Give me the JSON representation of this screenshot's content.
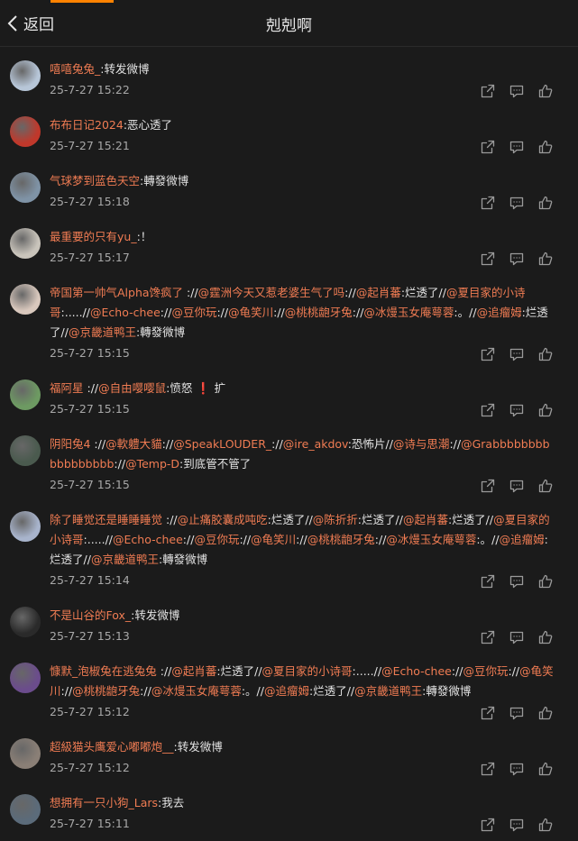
{
  "header": {
    "back_label": "返回",
    "title": "剋剋啊"
  },
  "comments": [
    {
      "name": "嘻嘻兔兔_",
      "segments": [
        {
          "t": ":转发微博"
        }
      ],
      "time": "25-7-27 15:22",
      "avatar": "#b7c6d8"
    },
    {
      "name": "布布日记2024",
      "segments": [
        {
          "t": ":恶心透了"
        }
      ],
      "time": "25-7-27 15:21",
      "avatar": "#c0382b"
    },
    {
      "name": "气球梦到蓝色天空",
      "segments": [
        {
          "t": ":轉發微博"
        }
      ],
      "time": "25-7-27 15:18",
      "avatar": "#7f93a6"
    },
    {
      "name": "最重要的只有yu_",
      "segments": [
        {
          "t": ":！"
        }
      ],
      "time": "25-7-27 15:17",
      "avatar": "#c9c4bb"
    },
    {
      "name": "帝国第一帅气Alpha馋疯了",
      "segments": [
        {
          "t": " ://"
        },
        {
          "t": "@霆洲今天又惹老婆生气了吗",
          "a": 1
        },
        {
          "t": "://"
        },
        {
          "t": "@起肖蕃",
          "a": 1
        },
        {
          "t": ":烂透了//"
        },
        {
          "t": "@夏目家的小诗哥",
          "a": 1
        },
        {
          "t": ":.....//"
        },
        {
          "t": "@Echo-chee",
          "a": 1
        },
        {
          "t": "://"
        },
        {
          "t": "@豆你玩",
          "a": 1
        },
        {
          "t": "://"
        },
        {
          "t": "@龟笑川",
          "a": 1
        },
        {
          "t": "://"
        },
        {
          "t": "@桃桃龅牙兔",
          "a": 1
        },
        {
          "t": "://"
        },
        {
          "t": "@冰熳玉女庵萼蓉",
          "a": 1
        },
        {
          "t": ":。//"
        },
        {
          "t": "@追瘤姆",
          "a": 1
        },
        {
          "t": ":烂透了//"
        },
        {
          "t": "@京畿道鸭王",
          "a": 1
        },
        {
          "t": ":轉發微博"
        }
      ],
      "time": "25-7-27 15:15",
      "avatar": "#d9c8bd"
    },
    {
      "name": "福阿星",
      "segments": [
        {
          "t": " ://"
        },
        {
          "t": "@自由嘤嘤鼠",
          "a": 1
        },
        {
          "t": ":愤怒"
        },
        {
          "t": " ❗ ",
          "r": 1
        },
        {
          "t": " 扩"
        }
      ],
      "time": "25-7-27 15:15",
      "avatar": "#6d9a62"
    },
    {
      "name": "阴阳兔4",
      "segments": [
        {
          "t": " ://"
        },
        {
          "t": "@軟軆大貓",
          "a": 1
        },
        {
          "t": "://"
        },
        {
          "t": "@SpeakLOUDER_",
          "a": 1
        },
        {
          "t": "://"
        },
        {
          "t": "@ire_akdov",
          "a": 1
        },
        {
          "t": ":恐怖片//"
        },
        {
          "t": "@诗与思潮",
          "a": 1
        },
        {
          "t": "://"
        },
        {
          "t": "@Grabbbbbbbbbbbbbbbbb",
          "a": 1
        },
        {
          "t": "://"
        },
        {
          "t": "@Temp-D",
          "a": 1
        },
        {
          "t": ":到底管不管了"
        }
      ],
      "time": "25-7-27 15:15",
      "avatar": "#4a5a4e"
    },
    {
      "name": "除了睡觉还是睡睡睡觉",
      "segments": [
        {
          "t": " ://"
        },
        {
          "t": "@止痛胶囊成吨吃",
          "a": 1
        },
        {
          "t": ":烂透了//"
        },
        {
          "t": "@陈折折",
          "a": 1
        },
        {
          "t": ":烂透了//"
        },
        {
          "t": "@起肖蕃",
          "a": 1
        },
        {
          "t": ":烂透了//"
        },
        {
          "t": "@夏目家的小诗哥",
          "a": 1
        },
        {
          "t": ":.....//"
        },
        {
          "t": "@Echo-chee",
          "a": 1
        },
        {
          "t": "://"
        },
        {
          "t": "@豆你玩",
          "a": 1
        },
        {
          "t": "://"
        },
        {
          "t": "@龟笑川",
          "a": 1
        },
        {
          "t": "://"
        },
        {
          "t": "@桃桃龅牙兔",
          "a": 1
        },
        {
          "t": "://"
        },
        {
          "t": "@冰熳玉女庵萼蓉",
          "a": 1
        },
        {
          "t": ":。//"
        },
        {
          "t": "@追瘤姆",
          "a": 1
        },
        {
          "t": ":烂透了//"
        },
        {
          "t": "@京畿道鸭王",
          "a": 1
        },
        {
          "t": ":轉發微博"
        }
      ],
      "time": "25-7-27 15:14",
      "avatar": "#a8b4cc"
    },
    {
      "name": "不是山谷的Fox_",
      "segments": [
        {
          "t": ":转发微博"
        }
      ],
      "time": "25-7-27 15:13",
      "avatar": "#2a2a2a"
    },
    {
      "name": "慷默_泡椒兔在逃兔兔",
      "segments": [
        {
          "t": " ://"
        },
        {
          "t": "@起肖蕃",
          "a": 1
        },
        {
          "t": ":烂透了//"
        },
        {
          "t": "@夏目家的小诗哥",
          "a": 1
        },
        {
          "t": ":.....//"
        },
        {
          "t": "@Echo-chee",
          "a": 1
        },
        {
          "t": "://"
        },
        {
          "t": "@豆你玩",
          "a": 1
        },
        {
          "t": "://"
        },
        {
          "t": "@龟笑川",
          "a": 1
        },
        {
          "t": "://"
        },
        {
          "t": "@桃桃龅牙兔",
          "a": 1
        },
        {
          "t": "://"
        },
        {
          "t": "@冰熳玉女庵萼蓉",
          "a": 1
        },
        {
          "t": ":。//"
        },
        {
          "t": "@追瘤姆",
          "a": 1
        },
        {
          "t": ":烂透了//"
        },
        {
          "t": "@京畿道鸭王",
          "a": 1
        },
        {
          "t": ":轉發微博"
        }
      ],
      "time": "25-7-27 15:12",
      "avatar": "#6b4c8c"
    },
    {
      "name": "超級猫头鹰爱心嘟嘟炮__",
      "segments": [
        {
          "t": ":转发微博"
        }
      ],
      "time": "25-7-27 15:12",
      "avatar": "#8a7f76"
    },
    {
      "name": "想拥有一只小狗_Lars",
      "segments": [
        {
          "t": ":我去"
        }
      ],
      "time": "25-7-27 15:11",
      "avatar": "#5b6b7a"
    }
  ]
}
